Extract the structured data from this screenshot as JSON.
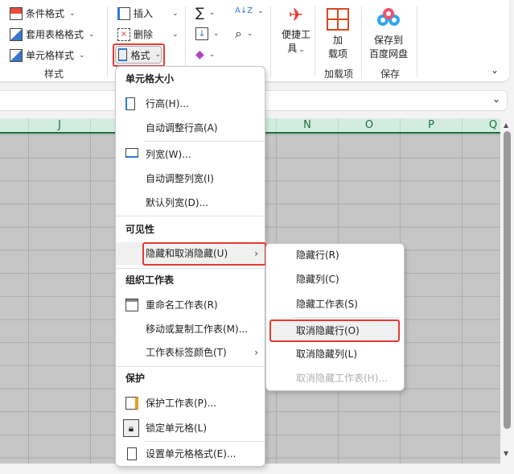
{
  "ribbon": {
    "styles": {
      "conditional_format": "条件格式",
      "table_format": "套用表格格式",
      "cell_styles": "单元格样式",
      "group": "样式"
    },
    "cells": {
      "insert": "插入",
      "delete": "删除",
      "format": "格式"
    },
    "editing": {
      "sum": "∑",
      "sort_filter": "A↓Z",
      "find": "⌕",
      "clear": "◆"
    },
    "quick_tools": {
      "label_line1": "便捷工",
      "label_line2": "具"
    },
    "addins": {
      "label_line1": "加",
      "label_line2": "载项",
      "group": "加载项"
    },
    "save": {
      "label_line1": "保存到",
      "label_line2": "百度网盘",
      "group": "保存"
    }
  },
  "columns": [
    "J",
    "N",
    "O",
    "P",
    "Q"
  ],
  "format_menu": {
    "sections": {
      "cell_size": "单元格大小",
      "visibility": "可见性",
      "organize": "组织工作表",
      "protect": "保护"
    },
    "items": {
      "row_height": "行高(H)...",
      "autofit_row": "自动调整行高(A)",
      "col_width": "列宽(W)...",
      "autofit_col": "自动调整列宽(I)",
      "default_width": "默认列宽(D)...",
      "hide_unhide": "隐藏和取消隐藏(U)",
      "rename": "重命名工作表(R)",
      "move_copy": "移动或复制工作表(M)...",
      "tab_color": "工作表标签颜色(T)",
      "protect_sheet": "保护工作表(P)...",
      "lock_cell": "锁定单元格(L)",
      "format_cells": "设置单元格格式(E)..."
    }
  },
  "hide_submenu": {
    "hide_rows": "隐藏行(R)",
    "hide_cols": "隐藏列(C)",
    "hide_sheet": "隐藏工作表(S)",
    "unhide_rows": "取消隐藏行(O)",
    "unhide_cols": "取消隐藏列(L)",
    "unhide_sheet": "取消隐藏工作表(H)..."
  },
  "colors": {
    "highlight_box": "#e53935",
    "column_header_bg": "#d3ece0",
    "accent_green": "#1e6e42"
  }
}
